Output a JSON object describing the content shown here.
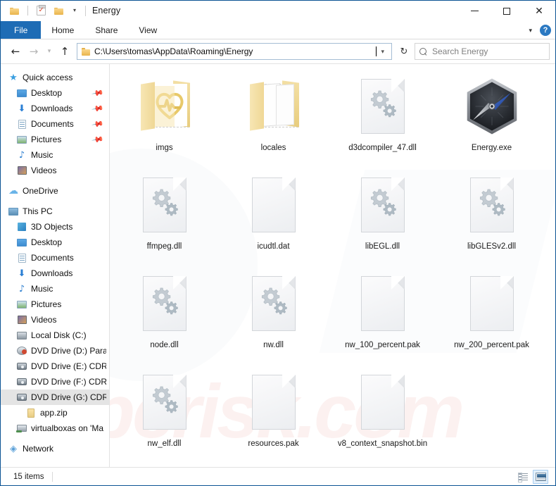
{
  "window": {
    "title": "Energy",
    "quick_access_toolbar": [
      {
        "name": "folder-icon",
        "label": "Folder"
      },
      {
        "name": "properties-icon",
        "label": "Properties"
      },
      {
        "name": "new-folder-icon",
        "label": "New folder"
      },
      {
        "name": "chevron-down-icon",
        "label": "Customize Quick Access Toolbar"
      }
    ],
    "controls": {
      "minimize": "─",
      "maximize": "□",
      "close": "✕"
    }
  },
  "ribbon": {
    "tabs": [
      {
        "label": "File",
        "active": true
      },
      {
        "label": "Home",
        "active": false
      },
      {
        "label": "Share",
        "active": false
      },
      {
        "label": "View",
        "active": false
      }
    ],
    "expand_label": "⌄",
    "help_label": "?"
  },
  "addressbar": {
    "back": "←",
    "forward": "→",
    "recent": "⌄",
    "up": "↑",
    "path": "C:\\Users\\tomas\\AppData\\Roaming\\Energy",
    "dropdown": "⌄",
    "refresh": "↻",
    "search_placeholder": "Search Energy",
    "search_value": ""
  },
  "sidebar": {
    "items": [
      {
        "label": "Quick access",
        "icon": "star-icon",
        "indent": 0,
        "pin": false,
        "gap": false,
        "selected": false
      },
      {
        "label": "Desktop",
        "icon": "desktop-icon",
        "indent": 1,
        "pin": true,
        "gap": false,
        "selected": false
      },
      {
        "label": "Downloads",
        "icon": "download-icon",
        "indent": 1,
        "pin": true,
        "gap": false,
        "selected": false
      },
      {
        "label": "Documents",
        "icon": "documents-icon",
        "indent": 1,
        "pin": true,
        "gap": false,
        "selected": false
      },
      {
        "label": "Pictures",
        "icon": "pictures-icon",
        "indent": 1,
        "pin": true,
        "gap": false,
        "selected": false
      },
      {
        "label": "Music",
        "icon": "music-icon",
        "indent": 1,
        "pin": false,
        "gap": false,
        "selected": false
      },
      {
        "label": "Videos",
        "icon": "videos-icon",
        "indent": 1,
        "pin": false,
        "gap": false,
        "selected": false
      },
      {
        "label": "OneDrive",
        "icon": "onedrive-icon",
        "indent": 0,
        "pin": false,
        "gap": true,
        "selected": false
      },
      {
        "label": "This PC",
        "icon": "this-pc-icon",
        "indent": 0,
        "pin": false,
        "gap": true,
        "selected": false
      },
      {
        "label": "3D Objects",
        "icon": "3d-objects-icon",
        "indent": 1,
        "pin": false,
        "gap": false,
        "selected": false
      },
      {
        "label": "Desktop",
        "icon": "desktop-icon",
        "indent": 1,
        "pin": false,
        "gap": false,
        "selected": false
      },
      {
        "label": "Documents",
        "icon": "documents-icon",
        "indent": 1,
        "pin": false,
        "gap": false,
        "selected": false
      },
      {
        "label": "Downloads",
        "icon": "download-icon",
        "indent": 1,
        "pin": false,
        "gap": false,
        "selected": false
      },
      {
        "label": "Music",
        "icon": "music-icon",
        "indent": 1,
        "pin": false,
        "gap": false,
        "selected": false
      },
      {
        "label": "Pictures",
        "icon": "pictures-icon",
        "indent": 1,
        "pin": false,
        "gap": false,
        "selected": false
      },
      {
        "label": "Videos",
        "icon": "videos-icon",
        "indent": 1,
        "pin": false,
        "gap": false,
        "selected": false
      },
      {
        "label": "Local Disk (C:)",
        "icon": "local-disk-icon",
        "indent": 1,
        "pin": false,
        "gap": false,
        "selected": false
      },
      {
        "label": "DVD Drive (D:) Paral",
        "icon": "dvd-drive-red-icon",
        "indent": 1,
        "pin": false,
        "gap": false,
        "selected": false
      },
      {
        "label": "DVD Drive (E:) CDRO",
        "icon": "dvd-drive-icon",
        "indent": 1,
        "pin": false,
        "gap": false,
        "selected": false
      },
      {
        "label": "DVD Drive (F:) CDRO",
        "icon": "dvd-drive-icon",
        "indent": 1,
        "pin": false,
        "gap": false,
        "selected": false
      },
      {
        "label": "DVD Drive (G:) CDRO",
        "icon": "dvd-drive-icon",
        "indent": 1,
        "pin": false,
        "gap": false,
        "selected": true
      },
      {
        "label": "app.zip",
        "icon": "zip-icon",
        "indent": 2,
        "pin": false,
        "gap": false,
        "selected": false
      },
      {
        "label": "virtualboxas on 'Ma",
        "icon": "network-drive-icon",
        "indent": 1,
        "pin": false,
        "gap": false,
        "selected": false
      },
      {
        "label": "Network",
        "icon": "network-icon",
        "indent": 0,
        "pin": false,
        "gap": true,
        "selected": false
      }
    ]
  },
  "files": [
    {
      "name": "imgs",
      "type": "folder-thumb",
      "icon": "folder-with-thumbnail-icon"
    },
    {
      "name": "locales",
      "type": "folder-papers",
      "icon": "folder-icon"
    },
    {
      "name": "d3dcompiler_47.dll",
      "type": "gears",
      "icon": "dll-file-icon"
    },
    {
      "name": "Energy.exe",
      "type": "hex",
      "icon": "energy-app-icon"
    },
    {
      "name": "ffmpeg.dll",
      "type": "gears",
      "icon": "dll-file-icon"
    },
    {
      "name": "icudtl.dat",
      "type": "blank",
      "icon": "generic-file-icon"
    },
    {
      "name": "libEGL.dll",
      "type": "gears",
      "icon": "dll-file-icon"
    },
    {
      "name": "libGLESv2.dll",
      "type": "gears",
      "icon": "dll-file-icon"
    },
    {
      "name": "node.dll",
      "type": "gears",
      "icon": "dll-file-icon"
    },
    {
      "name": "nw.dll",
      "type": "gears",
      "icon": "dll-file-icon"
    },
    {
      "name": "nw_100_percent.pak",
      "type": "blank",
      "icon": "generic-file-icon"
    },
    {
      "name": "nw_200_percent.pak",
      "type": "blank",
      "icon": "generic-file-icon"
    },
    {
      "name": "nw_elf.dll",
      "type": "gears",
      "icon": "dll-file-icon"
    },
    {
      "name": "resources.pak",
      "type": "blank",
      "icon": "generic-file-icon"
    },
    {
      "name": "v8_context_snapshot.bin",
      "type": "blank",
      "icon": "generic-file-icon"
    }
  ],
  "statusbar": {
    "item_count": "15 items",
    "views": [
      {
        "name": "details-view-button",
        "active": false
      },
      {
        "name": "large-icons-view-button",
        "active": true
      }
    ]
  },
  "watermark": {
    "text": "pcrisk.com"
  },
  "colors": {
    "accent": "#1e6cb5",
    "window_border": "#0b5394",
    "folder_yellow": "#efd795",
    "selection": "#e4e4e4"
  }
}
